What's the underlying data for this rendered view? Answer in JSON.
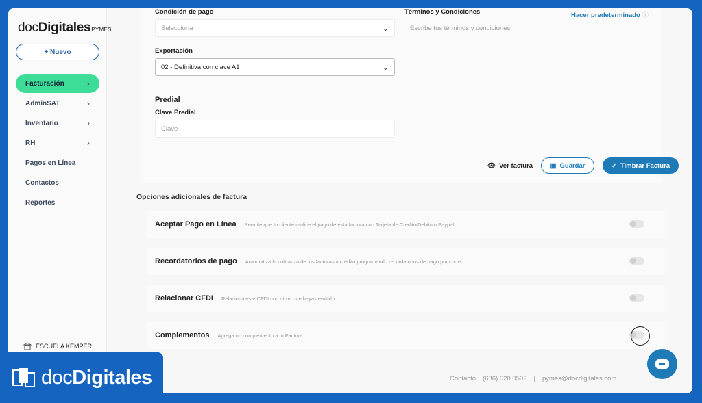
{
  "sidebar": {
    "logo_main": "docDigitales",
    "logo_prefix": "doc",
    "logo_bold": "Digitales",
    "logo_sub": "PYMES",
    "new_button": "+ Nuevo",
    "items": [
      {
        "label": "Facturación",
        "active": true,
        "chevron": true
      },
      {
        "label": "AdminSAT",
        "active": false,
        "chevron": true
      },
      {
        "label": "Inventario",
        "active": false,
        "chevron": true
      },
      {
        "label": "RH",
        "active": false,
        "chevron": true
      },
      {
        "label": "Pagos en Línea",
        "active": false,
        "chevron": false
      },
      {
        "label": "Contactos",
        "active": false,
        "chevron": false
      },
      {
        "label": "Reportes",
        "active": false,
        "chevron": false
      }
    ],
    "company": "ESCUELA KEMPER"
  },
  "form": {
    "payment_condition_label": "Condición de pago",
    "payment_condition_placeholder": "Selecciona",
    "terms_label": "Términos y Condiciones",
    "terms_placeholder": "Escribe tus términos y condiciones",
    "make_default_link": "Hacer predeterminado",
    "export_label": "Exportación",
    "export_value": "02 - Definitiva con clave A1",
    "predial_heading": "Predial",
    "predial_key_label": "Clave Predial",
    "predial_key_placeholder": "Clave"
  },
  "actions": {
    "view": "Ver factura",
    "save": "Guardar",
    "stamp": "Timbrar Factura"
  },
  "options": {
    "title": "Opciones adicionales de factura",
    "items": [
      {
        "title": "Aceptar Pago en Línea",
        "desc": "Permite que tu cliente realice el pago de esta factura con Tarjeta de Credito/Debito o Paypal.",
        "enabled": false
      },
      {
        "title": "Recordatorios de pago",
        "desc": "Automatiza la cobranza de tus facturas a crédito programando recordatorios de pago por correo.",
        "enabled": false
      },
      {
        "title": "Relacionar CFDI",
        "desc": "Relaciona este CFDI con otros que hayas emitido.",
        "enabled": false
      },
      {
        "title": "Complementos",
        "desc": "Agrega un complemento a tu Factura.",
        "enabled": false
      }
    ]
  },
  "footer": {
    "contact": "Contacto",
    "phone": "(686) 520 0503",
    "separator": "|",
    "email": "pymes@docdigitales.com"
  },
  "brand_overlay": {
    "prefix": "doc",
    "bold": "Digitales"
  },
  "colors": {
    "accent": "#1f7ab8",
    "active_nav": "#3ddc97",
    "background": "#1565c0"
  }
}
